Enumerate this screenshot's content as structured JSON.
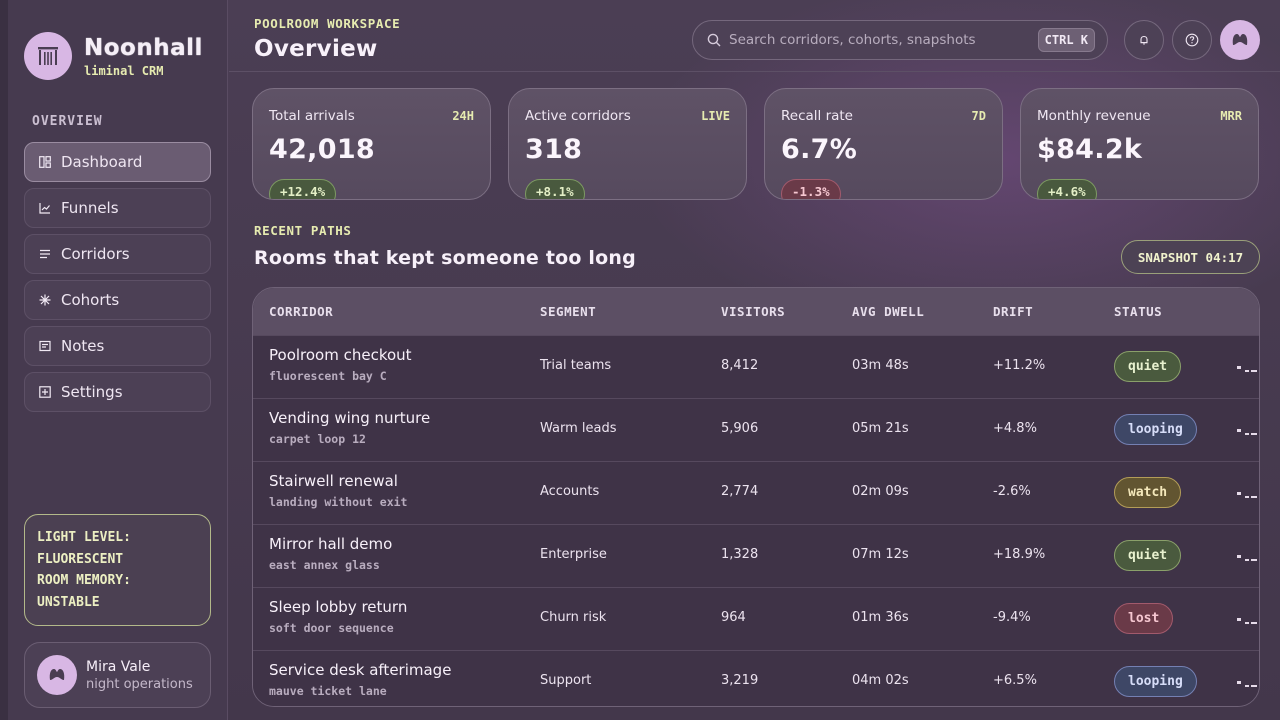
{
  "brand": {
    "name": "Noonhall",
    "sub": "liminal CRM"
  },
  "sidebar": {
    "section_label": "OVERVIEW",
    "items": [
      {
        "label": "Dashboard",
        "icon": "dashboard-icon",
        "active": true
      },
      {
        "label": "Funnels",
        "icon": "chart-line-icon"
      },
      {
        "label": "Corridors",
        "icon": "list-icon"
      },
      {
        "label": "Cohorts",
        "icon": "asterisk-icon"
      },
      {
        "label": "Notes",
        "icon": "note-icon"
      },
      {
        "label": "Settings",
        "icon": "settings-plus-icon"
      }
    ],
    "status_lines": [
      "LIGHT LEVEL:",
      "FLUORESCENT",
      "ROOM MEMORY:",
      "UNSTABLE"
    ],
    "user": {
      "name": "Mira Vale",
      "role": "night operations"
    }
  },
  "header": {
    "eyebrow": "POOLROOM WORKSPACE",
    "title": "Overview",
    "search_placeholder": "Search corridors, cohorts, snapshots",
    "shortcut": "CTRL K"
  },
  "kpis": [
    {
      "label": "Total arrivals",
      "tag": "24H",
      "value": "42,018",
      "delta": "+12.4%",
      "trend": "up"
    },
    {
      "label": "Active corridors",
      "tag": "LIVE",
      "value": "318",
      "delta": "+8.1%",
      "trend": "up"
    },
    {
      "label": "Recall rate",
      "tag": "7D",
      "value": "6.7%",
      "delta": "-1.3%",
      "trend": "down"
    },
    {
      "label": "Monthly revenue",
      "tag": "MRR",
      "value": "$84.2k",
      "delta": "+4.6%",
      "trend": "up"
    }
  ],
  "recent": {
    "eyebrow": "RECENT PATHS",
    "title": "Rooms that kept someone too long",
    "snapshot": "SNAPSHOT 04:17"
  },
  "table": {
    "columns": [
      "CORRIDOR",
      "SEGMENT",
      "VISITORS",
      "AVG DWELL",
      "DRIFT",
      "STATUS"
    ],
    "rows": [
      {
        "name": "Poolroom checkout",
        "sub": "fluorescent bay C",
        "segment": "Trial teams",
        "visitors": "8,412",
        "dwell": "03m 48s",
        "drift": "+11.2%",
        "status": "quiet"
      },
      {
        "name": "Vending wing nurture",
        "sub": "carpet loop 12",
        "segment": "Warm leads",
        "visitors": "5,906",
        "dwell": "05m 21s",
        "drift": "+4.8%",
        "status": "looping"
      },
      {
        "name": "Stairwell renewal",
        "sub": "landing without exit",
        "segment": "Accounts",
        "visitors": "2,774",
        "dwell": "02m 09s",
        "drift": "-2.6%",
        "status": "watch"
      },
      {
        "name": "Mirror hall demo",
        "sub": "east annex glass",
        "segment": "Enterprise",
        "visitors": "1,328",
        "dwell": "07m 12s",
        "drift": "+18.9%",
        "status": "quiet"
      },
      {
        "name": "Sleep lobby return",
        "sub": "soft door sequence",
        "segment": "Churn risk",
        "visitors": "964",
        "dwell": "01m 36s",
        "drift": "-9.4%",
        "status": "lost"
      },
      {
        "name": "Service desk afterimage",
        "sub": "mauve ticket lane",
        "segment": "Support",
        "visitors": "3,219",
        "dwell": "04m 02s",
        "drift": "+6.5%",
        "status": "looping"
      }
    ]
  }
}
